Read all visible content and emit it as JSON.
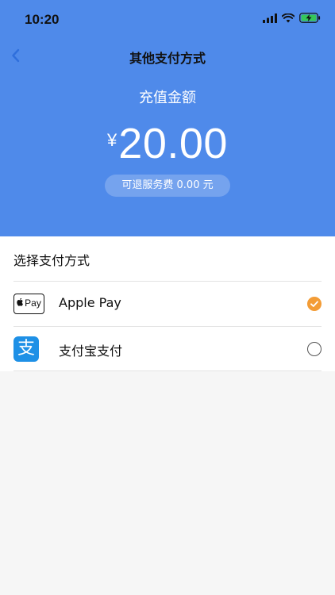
{
  "status_bar": {
    "time": "10:20"
  },
  "nav": {
    "title": "其他支付方式"
  },
  "recharge": {
    "label": "充值金额",
    "currency": "¥",
    "amount": "20.00",
    "fee_text": "可退服务费 0.00 元"
  },
  "payment": {
    "section_title": "选择支付方式",
    "options": [
      {
        "logo_text": "Pay",
        "label": "Apple Pay",
        "selected": true
      },
      {
        "logo_text": "支",
        "label": "支付宝支付",
        "selected": false
      }
    ]
  },
  "colors": {
    "header_bg": "#4f8aea",
    "selected_radio": "#f39c36",
    "alipay_blue": "#1e90e6"
  },
  "icons": {
    "back": "chevron-left-icon",
    "signal": "signal-icon",
    "wifi": "wifi-icon",
    "battery": "battery-charging-icon",
    "apple_pay": "apple-pay-logo",
    "alipay": "alipay-logo",
    "check": "check-icon"
  }
}
